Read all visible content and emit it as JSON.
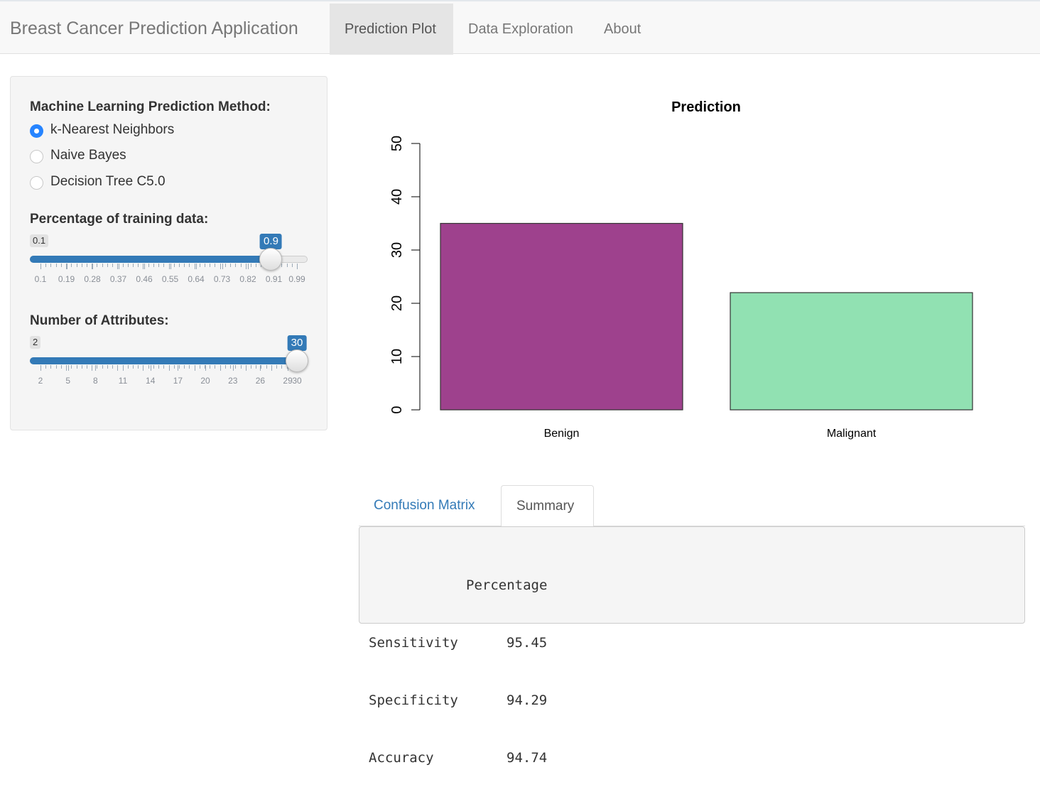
{
  "app": {
    "title": "Breast Cancer Prediction Application",
    "nav": [
      {
        "label": "Prediction Plot",
        "active": true
      },
      {
        "label": "Data Exploration",
        "active": false
      },
      {
        "label": "About",
        "active": false
      }
    ]
  },
  "sidebar": {
    "method": {
      "label": "Machine Learning Prediction Method:",
      "options": [
        "k-Nearest Neighbors",
        "Naive Bayes",
        "Decision Tree C5.0"
      ],
      "selected": "k-Nearest Neighbors"
    },
    "training": {
      "label": "Percentage of training data:",
      "min_label": "0.1",
      "value_label": "0.9",
      "min": 0.1,
      "max": 0.99,
      "value": 0.9,
      "ticks": [
        "0.1",
        "0.19",
        "0.28",
        "0.37",
        "0.46",
        "0.55",
        "0.64",
        "0.73",
        "0.82",
        "0.91",
        "0.99"
      ]
    },
    "attributes": {
      "label": "Number of Attributes:",
      "min_label": "2",
      "value_label": "30",
      "min": 2,
      "max": 30,
      "value": 30,
      "ticks": [
        "2",
        "5",
        "8",
        "11",
        "14",
        "17",
        "20",
        "23",
        "26",
        "29",
        "30"
      ]
    }
  },
  "chart_data": {
    "type": "bar",
    "title": "Prediction",
    "categories": [
      "Benign",
      "Malignant"
    ],
    "values": [
      35,
      22
    ],
    "colors": [
      "#9e418d",
      "#91e1b2"
    ],
    "yticks": [
      "0",
      "10",
      "20",
      "30",
      "40",
      "50"
    ],
    "ylim": [
      0,
      50
    ],
    "xlabel": "",
    "ylabel": "",
    "grid": false
  },
  "output_tabs": [
    {
      "label": "Confusion Matrix",
      "active": false
    },
    {
      "label": "Summary",
      "active": true
    }
  ],
  "summary": {
    "header": "Percentage",
    "rows": [
      {
        "name": "Sensitivity",
        "value": "95.45"
      },
      {
        "name": "Specificity",
        "value": "94.29"
      },
      {
        "name": "Accuracy",
        "value": "94.74"
      }
    ]
  },
  "colors": {
    "accent": "#337ab7",
    "radio_checked": "#2684ff"
  }
}
